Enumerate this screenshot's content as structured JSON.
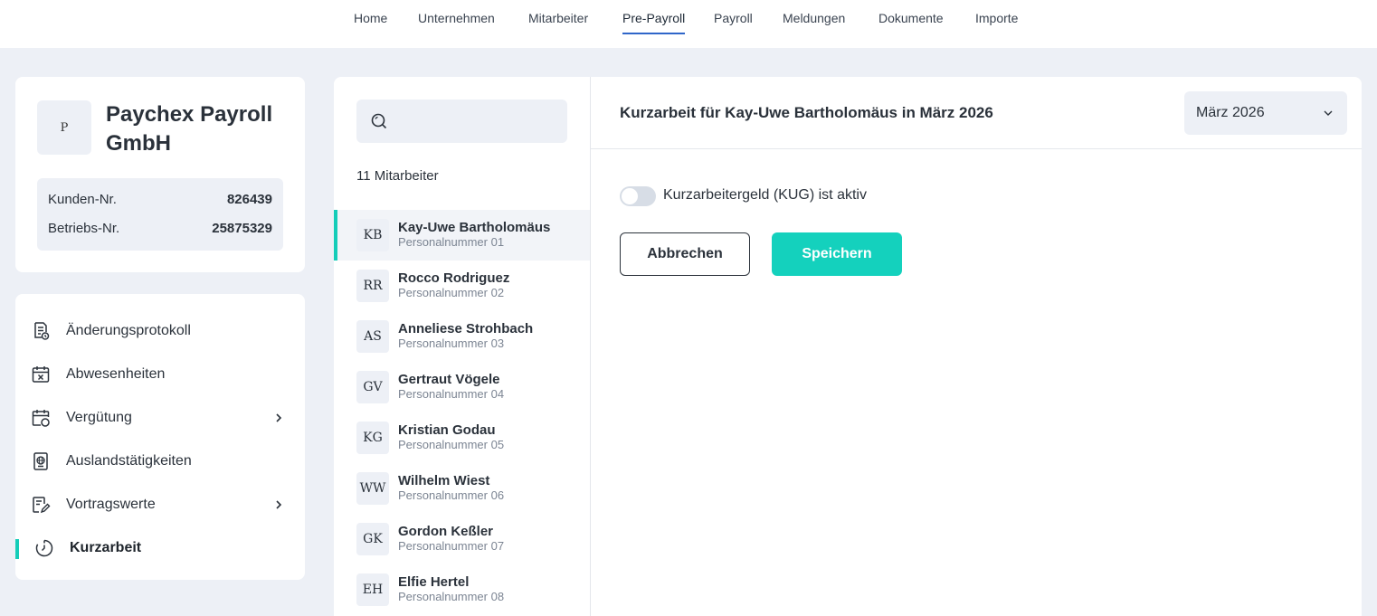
{
  "nav": {
    "items": [
      {
        "label": "Home"
      },
      {
        "label": "Unternehmen"
      },
      {
        "label": "Mitarbeiter"
      },
      {
        "label": "Pre-Payroll",
        "active": true
      },
      {
        "label": "Payroll"
      },
      {
        "label": "Meldungen"
      },
      {
        "label": "Dokumente"
      },
      {
        "label": "Importe"
      }
    ]
  },
  "company": {
    "logo_letter": "P",
    "name": "Paychex Payroll GmbH",
    "customer_label": "Kunden-Nr.",
    "customer_value": "826439",
    "business_label": "Betriebs-Nr.",
    "business_value": "25875329"
  },
  "menu": {
    "items": [
      {
        "label": "Änderungsprotokoll",
        "icon": "change-log-icon"
      },
      {
        "label": "Abwesenheiten",
        "icon": "calendar-x-icon"
      },
      {
        "label": "Vergütung",
        "icon": "calendar-coins-icon",
        "has_submenu": true
      },
      {
        "label": "Auslandstätigkeiten",
        "icon": "passport-icon"
      },
      {
        "label": "Vortragswerte",
        "icon": "edit-document-icon",
        "has_submenu": true
      },
      {
        "label": "Kurzarbeit",
        "icon": "timer-icon",
        "active": true
      }
    ]
  },
  "employees": {
    "search_placeholder": "",
    "count_label": "11 Mitarbeiter",
    "items": [
      {
        "initials": "KB",
        "name": "Kay-Uwe Bartholomäus",
        "number": "Personalnummer 01",
        "selected": true
      },
      {
        "initials": "RR",
        "name": "Rocco Rodriguez",
        "number": "Personalnummer 02"
      },
      {
        "initials": "AS",
        "name": "Anneliese Strohbach",
        "number": "Personalnummer 03"
      },
      {
        "initials": "GV",
        "name": "Gertraut Vögele",
        "number": "Personalnummer 04"
      },
      {
        "initials": "KG",
        "name": "Kristian Godau",
        "number": "Personalnummer 05"
      },
      {
        "initials": "WW",
        "name": "Wilhelm Wiest",
        "number": "Personalnummer 06"
      },
      {
        "initials": "GK",
        "name": "Gordon Keßler",
        "number": "Personalnummer 07"
      },
      {
        "initials": "EH",
        "name": "Elfie Hertel",
        "number": "Personalnummer 08"
      }
    ]
  },
  "detail": {
    "title": "Kurzarbeit für Kay-Uwe Bartholomäus in März 2026",
    "month_value": "März 2026",
    "toggle_label": "Kurzarbeitergeld (KUG) ist aktiv",
    "toggle_on": false,
    "cancel_label": "Abbrechen",
    "save_label": "Speichern"
  },
  "colors": {
    "accent": "#14cdb8",
    "nav_underline": "#2f66c9",
    "background": "#edf0f6"
  }
}
